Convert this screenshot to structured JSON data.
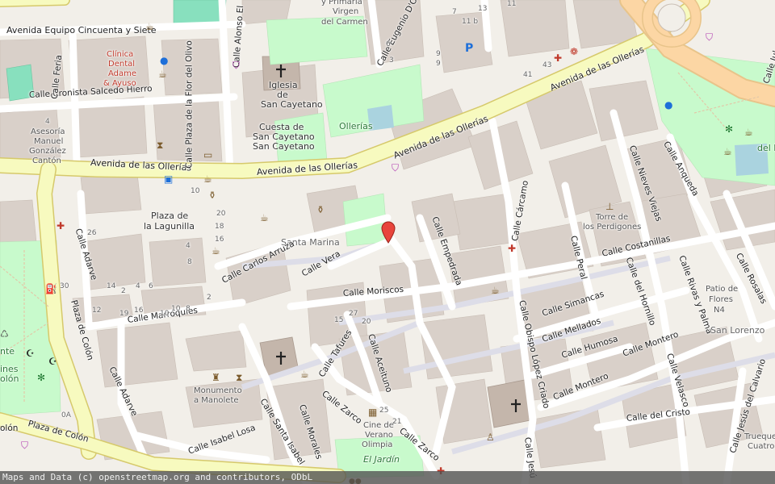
{
  "map": {
    "colors": {
      "land": "#f2efe9",
      "building": "#d9d0c9",
      "road_major": "#f7fabf",
      "road_major_casing": "#d6c96b",
      "road_minor": "#ffffff",
      "pedestrian": "#dddde8",
      "park": "#c8facc",
      "water": "#aad3df",
      "marker": "#e8453c",
      "pitch": "#88e0be"
    },
    "marker": {
      "name": "location-pin-icon"
    },
    "labels": {
      "av_equipo": "Avenida Equipo Cincuenta y Siete",
      "calle_cronista": "Calle Cronista Salcedo Hierro",
      "av_olleras_w": "Avenida de las Ollerías",
      "av_olleras_c": "Avenida de las Ollerías",
      "av_olleras_n1": "Avenida de las Ollerías",
      "av_olleras_ne": "Avenida de las Ollerías",
      "flor_olivo": "Calle Plaza de la Flor del Olivo",
      "alonso": "Calle Alonso El",
      "eugenio": "Calle Eugenio D'Ors",
      "primaria": "y Primaria",
      "virgen": "Virgen",
      "carmen": "del Carmen",
      "clinica1": "Clínica",
      "clinica2": "Dental",
      "clinica3": "Adame",
      "clinica4": "& Ayuso",
      "iglesia1": "Iglesia",
      "iglesia2": "de",
      "iglesia3": "San Cayetano",
      "cuesta1": "Cuesta de",
      "cuesta2": "San Cayetano",
      "cuesta3": "San Cayetano",
      "ollerias_park": "Ollerías",
      "asesoria1": "Asesoría",
      "asesoria2": "Manuel",
      "asesoria3": "González",
      "asesoria4": "Cantón",
      "feria": "Calle Feria",
      "plaza_lagunilla1": "Plaza de",
      "plaza_lagunilla2": "la Lagunilla",
      "santa_marina": "Santa Marina",
      "adarve_n": "Calle Adarve",
      "carlos_arruza": "Calle Carlos Arruza",
      "vera": "Calle Vera",
      "moriscos": "Calle Moriscos",
      "marroquies": "Calle Marroquíes",
      "plaza_colon_n": "Plaza de Colón",
      "plaza_colon_s": "Plaza de Colón",
      "colon_w": "olón",
      "adarve_s": "Calle Adarve",
      "tafures": "Calle Tafures",
      "aceituno": "Calle Aceituno",
      "empedrada": "Calle Empedrada",
      "carcamo": "Calle Cárcamo",
      "obispo": "Calle Obispo López Criado",
      "peral": "Calle Peral",
      "torre1": "Torre de",
      "torre2": "los Perdigones",
      "nieves": "Calle Nieves Viejas",
      "anqueda": "Calle Anqueda",
      "costanillas": "Calle Costanillas",
      "hornillo": "Calle del Hornillo",
      "simancas": "Calle Simancas",
      "mellados": "Calle Mellados",
      "humosa": "Calle Humosa",
      "montero": "Calle Montero",
      "montero2": "Calle Montero",
      "rivas": "Calle Rivas y Palma",
      "rosalas": "Calle Rosalas",
      "patio1": "Patio de",
      "patio2": "Flores",
      "patio3": "N4",
      "san_lorenzo": "San Lorenzo",
      "velasco": "Calle Velasco",
      "cristo": "Calle del Cristo",
      "jesus_calvario": "Calle Jesús del Calvario",
      "trueque1": "Trueque",
      "trueque2": "Cuatro",
      "monumento1": "Monumento",
      "monumento2": "a Manolete",
      "santa_isabel": "Calle Santa Isabel",
      "isabel_losa": "Calle Isabel Losa",
      "morales": "Calle Morales",
      "zarco1": "Calle Zarco",
      "zarco2": "Calle Zarco",
      "cine1": "Cine de",
      "cine2": "Verano",
      "cine3": "Olimpia",
      "jardin": "El Jardín",
      "jesus_s": "Calle Jesú",
      "mente1": "nte",
      "mente2": "ines",
      "mente3": "olón",
      "calle_jul": "Calle Jul",
      "del_e": "del E"
    },
    "numbers": [
      "6",
      "3",
      "9",
      "7",
      "11 b",
      "13",
      "41",
      "43",
      "10",
      "4",
      "20",
      "18",
      "16",
      "26",
      "30",
      "12",
      "10",
      "8",
      "2",
      "4",
      "6",
      "15",
      "27",
      "20",
      "0A",
      "25",
      "21",
      "10",
      "2",
      "4",
      "8",
      "14",
      "16",
      "19",
      "9",
      "11"
    ]
  },
  "attribution": "Maps and Data (c) openstreetmap.org and contributors, ODbL"
}
